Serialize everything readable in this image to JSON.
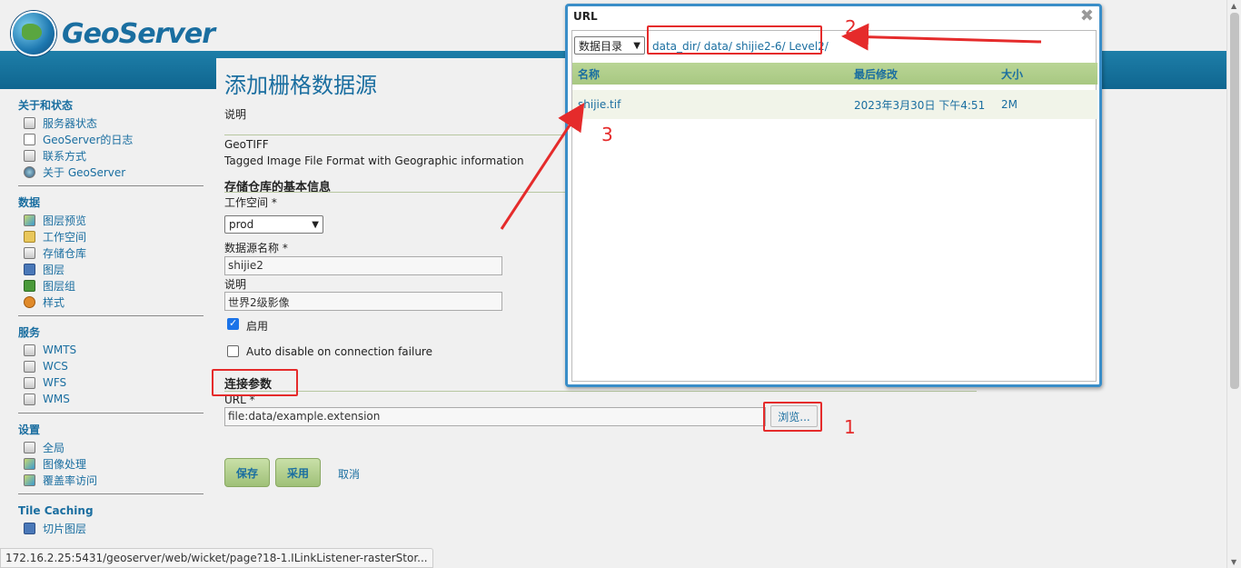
{
  "header": {
    "brand": "GeoServer"
  },
  "sidebar": {
    "sections": [
      {
        "title": "关于和状态",
        "items": [
          {
            "label": "服务器状态",
            "icon": "server-status-icon"
          },
          {
            "label": "GeoServer的日志",
            "icon": "log-document-icon"
          },
          {
            "label": "联系方式",
            "icon": "contact-card-icon"
          },
          {
            "label": "关于 GeoServer",
            "icon": "about-info-icon"
          }
        ]
      },
      {
        "title": "数据",
        "items": [
          {
            "label": "图层预览",
            "icon": "layer-preview-icon"
          },
          {
            "label": "工作空间",
            "icon": "workspace-folder-icon"
          },
          {
            "label": "存储仓库",
            "icon": "store-database-icon"
          },
          {
            "label": "图层",
            "icon": "layer-icon"
          },
          {
            "label": "图层组",
            "icon": "layer-group-icon"
          },
          {
            "label": "样式",
            "icon": "style-palette-icon"
          }
        ]
      },
      {
        "title": "服务",
        "items": [
          {
            "label": "WMTS",
            "icon": "service-icon"
          },
          {
            "label": "WCS",
            "icon": "service-icon"
          },
          {
            "label": "WFS",
            "icon": "service-icon"
          },
          {
            "label": "WMS",
            "icon": "service-icon"
          }
        ]
      },
      {
        "title": "设置",
        "items": [
          {
            "label": "全局",
            "icon": "global-settings-icon"
          },
          {
            "label": "图像处理",
            "icon": "image-processing-icon"
          },
          {
            "label": "覆盖率访问",
            "icon": "coverage-access-icon"
          }
        ]
      },
      {
        "title": "Tile Caching",
        "items": [
          {
            "label": "切片图层",
            "icon": "tile-layers-icon"
          }
        ]
      }
    ]
  },
  "main": {
    "title": "添加栅格数据源",
    "description_label": "说明",
    "format_name": "GeoTIFF",
    "format_description": "Tagged Image File Format with Geographic information",
    "basic_info_title": "存储仓库的基本信息",
    "workspace_label": "工作空间 *",
    "workspace_value": "prod",
    "datasource_name_label": "数据源名称 *",
    "datasource_name_value": "shijie2",
    "description_field_label": "说明",
    "description_field_value": "世界2级影像",
    "enabled_label": "启用",
    "enabled_checked": true,
    "auto_disable_label": "Auto disable on connection failure",
    "auto_disable_checked": false,
    "connection_params_title": "连接参数",
    "url_label": "URL *",
    "url_value": "file:data/example.extension",
    "browse_label": "浏览...",
    "save_label": "保存",
    "apply_label": "采用",
    "cancel_label": "取消"
  },
  "dialog": {
    "title": "URL",
    "root_select": "数据目录",
    "path": [
      "data_dir/",
      "data/",
      "shijie2-6/",
      "Level2/"
    ],
    "columns": [
      "名称",
      "最后修改",
      "大小"
    ],
    "rows": [
      {
        "name": "shijie.tif",
        "modified": "2023年3月30日 下午4:51",
        "size": "2M"
      }
    ]
  },
  "annotations": {
    "numbers": [
      "1",
      "2",
      "3"
    ],
    "color": "#e52b2b"
  },
  "statusbar": {
    "url": "172.16.2.25:5431/geoserver/web/wicket/page?18-1.ILinkListener-rasterStor..."
  },
  "colors": {
    "accent": "#1a6ea0",
    "header_band": "#1e7ea8",
    "button_green": "#b4d18e",
    "annotation_red": "#e52b2b"
  }
}
